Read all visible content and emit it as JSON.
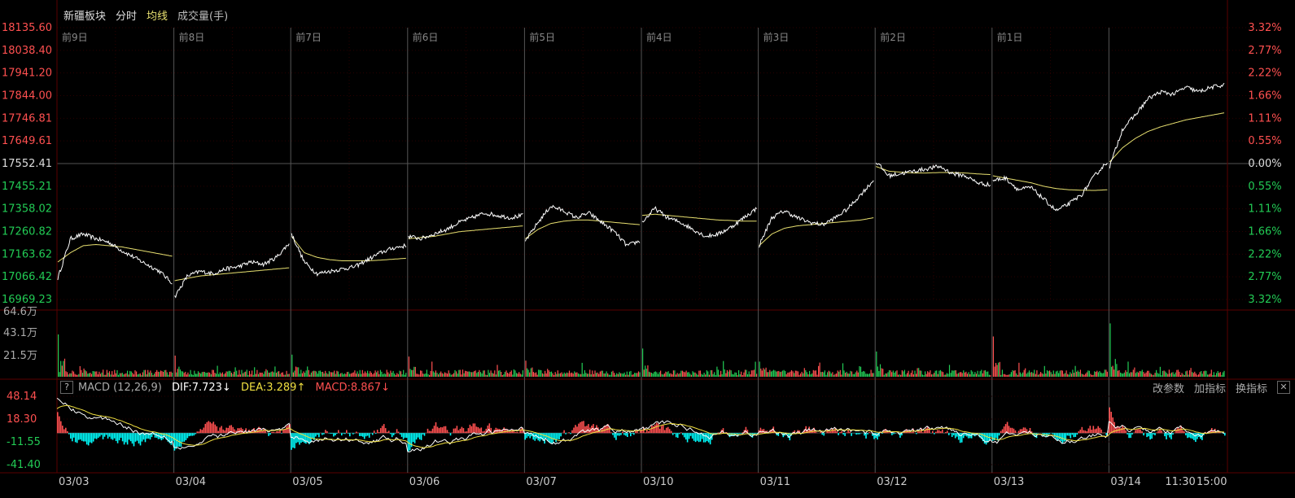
{
  "header": {
    "sector_name": "新疆板块",
    "tab_intraday": "分时",
    "tab_avg": "均线",
    "tab_volume": "成交量(手)"
  },
  "macd_bar": {
    "help": "?",
    "title": "MACD (12,26,9)",
    "dif": "DIF:7.723↓",
    "dea": "DEA:3.289↑",
    "macd": "MACD:8.867↓",
    "btn_params": "改参数",
    "btn_add": "加指标",
    "btn_switch": "换指标",
    "btn_close": "✕"
  },
  "colors": {
    "up": "#ff5050",
    "down": "#22cc55",
    "price_line": "#ffffff",
    "avg_line": "#e8e070",
    "grid": "#3a0000",
    "cyan": "#00ffff"
  },
  "chart_data": [
    {
      "type": "line",
      "name": "price_intraday",
      "prev_close": 17552.41,
      "ylim": [
        16969.23,
        18135.6
      ],
      "y_ticks_left": [
        "18135.60",
        "18038.40",
        "17941.20",
        "17844.00",
        "17746.81",
        "17649.61",
        "17552.41",
        "17455.21",
        "17358.02",
        "17260.82",
        "17163.62",
        "17066.42",
        "16969.23"
      ],
      "y_ticks_right": [
        "3.32%",
        "2.77%",
        "2.22%",
        "1.66%",
        "1.11%",
        "0.55%",
        "0.00%",
        "0.55%",
        "1.11%",
        "1.66%",
        "2.22%",
        "2.77%",
        "3.32%"
      ],
      "day_labels": [
        "前9日",
        "前8日",
        "前7日",
        "前6日",
        "前5日",
        "前4日",
        "前3日",
        "前2日",
        "前1日",
        ""
      ],
      "sessions": [
        {
          "price": [
            17060,
            17230,
            17250,
            17230,
            17215,
            17180,
            17150,
            17120,
            17090,
            17040
          ],
          "avg": [
            17130,
            17170,
            17200,
            17205,
            17200,
            17195,
            17185,
            17175,
            17165,
            17155
          ]
        },
        {
          "price": [
            16980,
            17070,
            17090,
            17080,
            17100,
            17110,
            17130,
            17120,
            17150,
            17210
          ],
          "avg": [
            17050,
            17060,
            17070,
            17075,
            17080,
            17085,
            17090,
            17095,
            17100,
            17105
          ]
        },
        {
          "price": [
            17250,
            17130,
            17080,
            17090,
            17100,
            17110,
            17140,
            17170,
            17190,
            17200
          ],
          "avg": [
            17240,
            17170,
            17150,
            17140,
            17135,
            17135,
            17135,
            17138,
            17142,
            17146
          ]
        },
        {
          "price": [
            17240,
            17230,
            17250,
            17270,
            17300,
            17320,
            17340,
            17330,
            17320,
            17330
          ],
          "avg": [
            17230,
            17235,
            17240,
            17250,
            17260,
            17265,
            17270,
            17275,
            17280,
            17285
          ]
        },
        {
          "price": [
            17220,
            17300,
            17370,
            17350,
            17320,
            17340,
            17300,
            17260,
            17200,
            17220
          ],
          "avg": [
            17230,
            17270,
            17295,
            17305,
            17310,
            17310,
            17305,
            17300,
            17295,
            17290
          ]
        },
        {
          "price": [
            17300,
            17360,
            17320,
            17300,
            17270,
            17240,
            17250,
            17280,
            17320,
            17360
          ],
          "avg": [
            17330,
            17335,
            17330,
            17325,
            17320,
            17315,
            17310,
            17308,
            17305,
            17305
          ]
        },
        {
          "price": [
            17200,
            17320,
            17350,
            17320,
            17300,
            17290,
            17320,
            17360,
            17420,
            17480
          ],
          "avg": [
            17200,
            17250,
            17275,
            17285,
            17290,
            17295,
            17300,
            17305,
            17310,
            17320
          ]
        },
        {
          "price": [
            17560,
            17500,
            17510,
            17520,
            17530,
            17540,
            17510,
            17500,
            17470,
            17460
          ],
          "avg": [
            17540,
            17520,
            17515,
            17512,
            17512,
            17514,
            17514,
            17512,
            17508,
            17505
          ]
        },
        {
          "price": [
            17480,
            17490,
            17440,
            17450,
            17400,
            17350,
            17380,
            17420,
            17500,
            17560
          ],
          "avg": [
            17500,
            17490,
            17480,
            17470,
            17455,
            17445,
            17440,
            17438,
            17437,
            17440
          ]
        },
        {
          "price": [
            17540,
            17700,
            17760,
            17830,
            17860,
            17850,
            17880,
            17860,
            17880,
            17890
          ],
          "avg": [
            17560,
            17620,
            17660,
            17690,
            17710,
            17725,
            17740,
            17750,
            17760,
            17770
          ]
        }
      ]
    },
    {
      "type": "bar",
      "name": "volume",
      "ylabel": "成交量(手)",
      "y_ticks": [
        "64.6万",
        "43.1万",
        "21.5万"
      ],
      "ylim": [
        0,
        646000
      ],
      "session_open_spikes": [
        420000,
        210000,
        220000,
        200000,
        160000,
        280000,
        150000,
        250000,
        400000,
        530000
      ]
    },
    {
      "type": "bar",
      "name": "MACD",
      "y_ticks": [
        "48.14",
        "18.30",
        "-11.55",
        "-41.40"
      ],
      "ylim": [
        -41.4,
        48.14
      ],
      "dif": 7.723,
      "dea": 3.289,
      "macd": 8.867,
      "x_labels": [
        "03/03",
        "03/04",
        "03/05",
        "03/06",
        "03/07",
        "03/10",
        "03/11",
        "03/12",
        "03/13",
        "03/14",
        "11:30",
        "15:00"
      ]
    }
  ]
}
